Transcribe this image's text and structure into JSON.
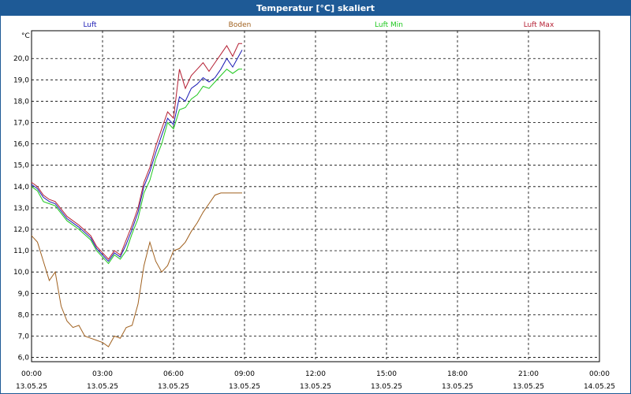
{
  "window": {
    "title": "Temperatur [°C] skaliert"
  },
  "chart_data": {
    "type": "line",
    "title": "Temperatur [°C] skaliert",
    "ylabel": "°C",
    "xlabel": "",
    "ylim": [
      5.8,
      21.3
    ],
    "xlim": [
      "2025-05-13T00:00",
      "2025-05-14T00:00"
    ],
    "grid": true,
    "legend_placement": "top",
    "y_ticks": [
      "6,0",
      "7,0",
      "8,0",
      "9,0",
      "10,0",
      "11,0",
      "12,0",
      "13,0",
      "14,0",
      "15,0",
      "16,0",
      "17,0",
      "18,0",
      "19,0",
      "20,0"
    ],
    "y_tick_values": [
      6,
      7,
      8,
      9,
      10,
      11,
      12,
      13,
      14,
      15,
      16,
      17,
      18,
      19,
      20
    ],
    "x_ticks": [
      {
        "time": "00:00",
        "date": "13.05.25"
      },
      {
        "time": "03:00",
        "date": "13.05.25"
      },
      {
        "time": "06:00",
        "date": "13.05.25"
      },
      {
        "time": "09:00",
        "date": "13.05.25"
      },
      {
        "time": "12:00",
        "date": "13.05.25"
      },
      {
        "time": "15:00",
        "date": "13.05.25"
      },
      {
        "time": "18:00",
        "date": "13.05.25"
      },
      {
        "time": "21:00",
        "date": "13.05.25"
      },
      {
        "time": "00:00",
        "date": "14.05.25"
      }
    ],
    "series": [
      {
        "name": "Luft",
        "color": "#1a1ab4",
        "x": [
          0,
          0.25,
          0.5,
          0.75,
          1,
          1.5,
          2,
          2.5,
          2.75,
          3,
          3.25,
          3.5,
          3.75,
          4,
          4.25,
          4.5,
          4.75,
          5,
          5.25,
          5.5,
          5.75,
          6,
          6.25,
          6.5,
          6.75,
          7,
          7.25,
          7.5,
          7.75,
          8,
          8.25,
          8.5,
          8.75,
          8.9
        ],
        "y": [
          14.1,
          13.9,
          13.5,
          13.3,
          13.2,
          12.5,
          12.1,
          11.6,
          11.1,
          10.8,
          10.5,
          10.9,
          10.7,
          11.3,
          12.0,
          12.8,
          14.0,
          14.7,
          15.6,
          16.4,
          17.2,
          16.9,
          18.2,
          18.0,
          18.6,
          18.8,
          19.1,
          18.9,
          19.1,
          19.5,
          20.0,
          19.6,
          20.1,
          20.4
        ]
      },
      {
        "name": "Boden",
        "color": "#a0601e",
        "x": [
          0,
          0.25,
          0.5,
          0.75,
          1,
          1.25,
          1.5,
          1.75,
          2,
          2.25,
          2.5,
          2.75,
          3,
          3.25,
          3.5,
          3.75,
          4,
          4.25,
          4.5,
          4.75,
          5,
          5.25,
          5.5,
          5.75,
          6,
          6.25,
          6.5,
          6.75,
          7,
          7.25,
          7.5,
          7.75,
          8,
          8.25,
          8.5,
          8.75,
          8.9
        ],
        "y": [
          11.7,
          11.4,
          10.5,
          9.6,
          10.0,
          8.4,
          7.7,
          7.4,
          7.5,
          7.0,
          6.9,
          6.8,
          6.7,
          6.5,
          7.0,
          6.9,
          7.4,
          7.5,
          8.5,
          10.3,
          11.4,
          10.5,
          10.0,
          10.3,
          11.0,
          11.1,
          11.4,
          11.9,
          12.3,
          12.8,
          13.2,
          13.6,
          13.7,
          13.7,
          13.7,
          13.7,
          13.7
        ]
      },
      {
        "name": "Luft Min",
        "color": "#1ec81e",
        "x": [
          0,
          0.25,
          0.5,
          0.75,
          1,
          1.5,
          2,
          2.5,
          2.75,
          3,
          3.25,
          3.5,
          3.75,
          4,
          4.25,
          4.5,
          4.75,
          5,
          5.25,
          5.5,
          5.75,
          6,
          6.25,
          6.5,
          6.75,
          7,
          7.25,
          7.5,
          7.75,
          8,
          8.25,
          8.5,
          8.75,
          8.9
        ],
        "y": [
          14.0,
          13.8,
          13.3,
          13.2,
          13.1,
          12.4,
          12.0,
          11.5,
          11.0,
          10.7,
          10.4,
          10.8,
          10.6,
          11.0,
          11.8,
          12.5,
          13.7,
          14.3,
          15.3,
          16.0,
          17.0,
          16.7,
          17.6,
          17.7,
          18.1,
          18.3,
          18.7,
          18.6,
          18.9,
          19.2,
          19.5,
          19.3,
          19.5,
          19.5
        ]
      },
      {
        "name": "Luft Max",
        "color": "#b41e32",
        "x": [
          0,
          0.25,
          0.5,
          0.75,
          1,
          1.5,
          2,
          2.5,
          2.75,
          3,
          3.25,
          3.5,
          3.75,
          4,
          4.25,
          4.5,
          4.75,
          5,
          5.25,
          5.5,
          5.75,
          6,
          6.25,
          6.5,
          6.75,
          7,
          7.25,
          7.5,
          7.75,
          8,
          8.25,
          8.5,
          8.75,
          8.9
        ],
        "y": [
          14.2,
          14.0,
          13.6,
          13.4,
          13.3,
          12.6,
          12.2,
          11.7,
          11.2,
          10.9,
          10.6,
          11.0,
          10.8,
          11.5,
          12.2,
          13.0,
          14.2,
          14.9,
          15.9,
          16.7,
          17.5,
          17.2,
          19.5,
          18.6,
          19.2,
          19.5,
          19.8,
          19.4,
          19.8,
          20.2,
          20.6,
          20.1,
          20.7,
          20.7
        ]
      }
    ]
  }
}
